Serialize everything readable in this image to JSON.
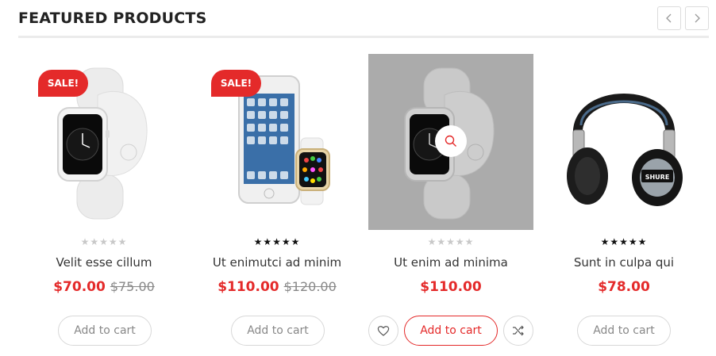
{
  "section": {
    "title": "FEATURED PRODUCTS"
  },
  "colors": {
    "accent": "#e42a2a",
    "overlay": "#ababab"
  },
  "products": [
    {
      "name": "Velit esse cillum",
      "price": "$70.00",
      "old_price": "$75.00",
      "badge": "SALE!",
      "rating": 0,
      "cart_label": "Add to cart",
      "icon": "smartwatch-white"
    },
    {
      "name": "Ut enimutci ad minim",
      "price": "$110.00",
      "old_price": "$120.00",
      "badge": "SALE!",
      "rating": 5,
      "cart_label": "Add to cart",
      "icon": "phone-and-watch"
    },
    {
      "name": "Ut enim ad minima",
      "price": "$110.00",
      "old_price": "",
      "badge": "",
      "rating": 0,
      "cart_label": "Add to cart",
      "icon": "smartwatch-gray"
    },
    {
      "name": "Sunt in culpa qui",
      "price": "$78.00",
      "old_price": "",
      "badge": "",
      "rating": 5,
      "cart_label": "Add to cart",
      "icon": "headphones"
    }
  ]
}
